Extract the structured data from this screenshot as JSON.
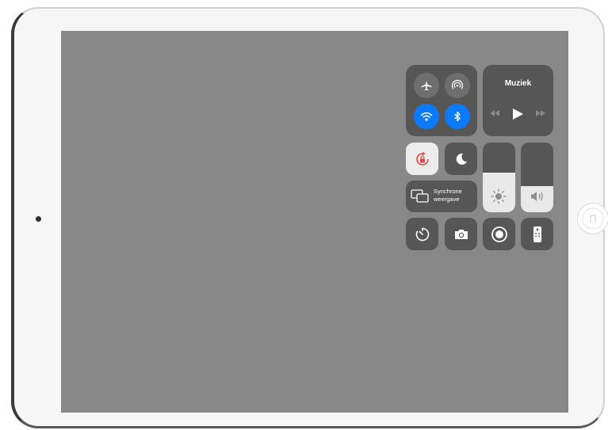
{
  "device": {
    "name": "iPad"
  },
  "status_bar": {
    "text": ""
  },
  "control_center": {
    "connectivity": {
      "airplane_mode": {
        "icon": "airplane-icon",
        "active": false
      },
      "airdrop": {
        "icon": "airdrop-icon",
        "active": false
      },
      "wifi": {
        "icon": "wifi-icon",
        "active": true,
        "color": "#0a7aff"
      },
      "bluetooth": {
        "icon": "bluetooth-icon",
        "active": true,
        "color": "#0a7aff"
      }
    },
    "music": {
      "title": "Muziek",
      "controls": [
        "rewind-icon",
        "play-icon",
        "fast-forward-icon"
      ]
    },
    "rotation_lock": {
      "icon": "rotation-lock-icon",
      "active": true,
      "color": "#e5453d"
    },
    "do_not_disturb": {
      "icon": "moon-icon",
      "active": false
    },
    "screen_mirroring": {
      "label_line1": "Synchrone",
      "label_line2": "weergave",
      "icon": "screen-mirroring-icon"
    },
    "brightness": {
      "icon": "sun-icon",
      "level": 0.57
    },
    "volume": {
      "icon": "speaker-icon",
      "level": 0.37
    },
    "bottom_row": [
      {
        "name": "timer",
        "icon": "timer-icon"
      },
      {
        "name": "camera",
        "icon": "camera-icon"
      },
      {
        "name": "screen-recording",
        "icon": "record-icon"
      },
      {
        "name": "apple-tv-remote",
        "icon": "remote-icon"
      }
    ]
  }
}
